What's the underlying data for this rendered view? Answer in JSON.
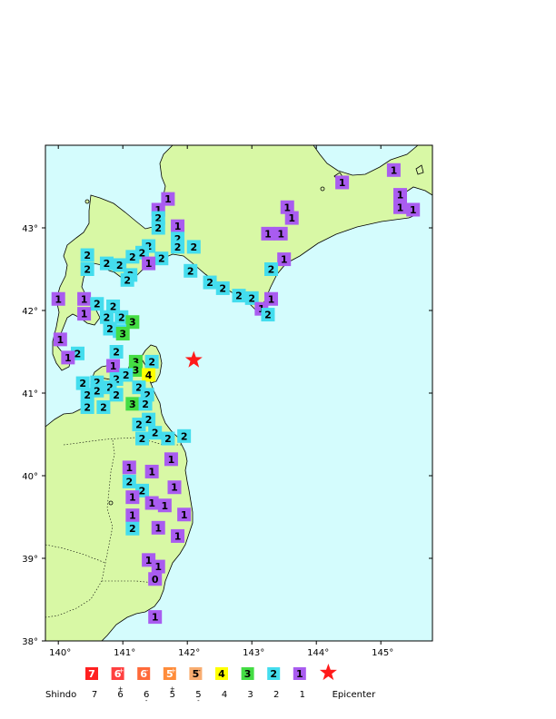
{
  "map": {
    "lon_range": [
      139.8,
      145.8
    ],
    "lat_range": [
      38.0,
      44.0
    ],
    "lon_ticks": [
      "140",
      "141",
      "142",
      "143",
      "144",
      "145"
    ],
    "lat_ticks": [
      "43",
      "42",
      "41",
      "40",
      "39",
      "38"
    ],
    "degree_symbol": "°",
    "sea_color": "#d4fcfd",
    "land_color": "#d8f8a5"
  },
  "epicenter": {
    "lon": 142.1,
    "lat": 41.4,
    "color": "#ff1a1a"
  },
  "stations": [
    {
      "s": "1",
      "lon": 141.7,
      "lat": 43.35
    },
    {
      "s": "1",
      "lon": 141.55,
      "lat": 43.22
    },
    {
      "s": "2",
      "lon": 141.55,
      "lat": 43.12
    },
    {
      "s": "2",
      "lon": 141.55,
      "lat": 43.0
    },
    {
      "s": "1",
      "lon": 141.85,
      "lat": 43.02
    },
    {
      "s": "2",
      "lon": 141.85,
      "lat": 42.87
    },
    {
      "s": "2",
      "lon": 141.85,
      "lat": 42.77
    },
    {
      "s": "2",
      "lon": 142.1,
      "lat": 42.77
    },
    {
      "s": "2",
      "lon": 141.4,
      "lat": 42.78
    },
    {
      "s": "2",
      "lon": 141.3,
      "lat": 42.7
    },
    {
      "s": "2",
      "lon": 141.6,
      "lat": 42.63
    },
    {
      "s": "1",
      "lon": 141.4,
      "lat": 42.57
    },
    {
      "s": "2",
      "lon": 140.45,
      "lat": 42.67
    },
    {
      "s": "2",
      "lon": 140.45,
      "lat": 42.5
    },
    {
      "s": "2",
      "lon": 140.75,
      "lat": 42.57
    },
    {
      "s": "2",
      "lon": 140.95,
      "lat": 42.55
    },
    {
      "s": "2",
      "lon": 141.15,
      "lat": 42.65
    },
    {
      "s": "2",
      "lon": 141.12,
      "lat": 42.43
    },
    {
      "s": "2",
      "lon": 141.07,
      "lat": 42.37
    },
    {
      "s": "2",
      "lon": 142.05,
      "lat": 42.48
    },
    {
      "s": "2",
      "lon": 142.35,
      "lat": 42.34
    },
    {
      "s": "2",
      "lon": 142.55,
      "lat": 42.27
    },
    {
      "s": "2",
      "lon": 142.8,
      "lat": 42.18
    },
    {
      "s": "2",
      "lon": 143.0,
      "lat": 42.15
    },
    {
      "s": "1",
      "lon": 143.3,
      "lat": 42.14
    },
    {
      "s": "1",
      "lon": 143.15,
      "lat": 42.02
    },
    {
      "s": "2",
      "lon": 143.25,
      "lat": 41.95
    },
    {
      "s": "1",
      "lon": 143.55,
      "lat": 43.25
    },
    {
      "s": "1",
      "lon": 143.62,
      "lat": 43.12
    },
    {
      "s": "1",
      "lon": 143.25,
      "lat": 42.93
    },
    {
      "s": "1",
      "lon": 143.45,
      "lat": 42.93
    },
    {
      "s": "1",
      "lon": 143.5,
      "lat": 42.62
    },
    {
      "s": "2",
      "lon": 143.3,
      "lat": 42.5
    },
    {
      "s": "1",
      "lon": 144.4,
      "lat": 43.55
    },
    {
      "s": "1",
      "lon": 145.2,
      "lat": 43.7
    },
    {
      "s": "1",
      "lon": 145.3,
      "lat": 43.4
    },
    {
      "s": "1",
      "lon": 145.3,
      "lat": 43.25
    },
    {
      "s": "1",
      "lon": 145.5,
      "lat": 43.22
    },
    {
      "s": "1",
      "lon": 140.0,
      "lat": 42.14
    },
    {
      "s": "1",
      "lon": 140.4,
      "lat": 42.14
    },
    {
      "s": "2",
      "lon": 140.6,
      "lat": 42.08
    },
    {
      "s": "2",
      "lon": 140.85,
      "lat": 42.05
    },
    {
      "s": "1",
      "lon": 140.4,
      "lat": 41.96
    },
    {
      "s": "2",
      "lon": 140.75,
      "lat": 41.92
    },
    {
      "s": "2",
      "lon": 140.98,
      "lat": 41.92
    },
    {
      "s": "3",
      "lon": 141.15,
      "lat": 41.86
    },
    {
      "s": "2",
      "lon": 140.8,
      "lat": 41.78
    },
    {
      "s": "2",
      "lon": 140.95,
      "lat": 41.75
    },
    {
      "s": "3",
      "lon": 141.0,
      "lat": 41.72
    },
    {
      "s": "1",
      "lon": 140.03,
      "lat": 41.65
    },
    {
      "s": "2",
      "lon": 140.3,
      "lat": 41.48
    },
    {
      "s": "1",
      "lon": 140.15,
      "lat": 41.43
    },
    {
      "s": "2",
      "lon": 140.9,
      "lat": 41.5
    },
    {
      "s": "1",
      "lon": 140.85,
      "lat": 41.33
    },
    {
      "s": "3",
      "lon": 141.2,
      "lat": 41.38
    },
    {
      "s": "2",
      "lon": 141.45,
      "lat": 41.38
    },
    {
      "s": "3",
      "lon": 141.2,
      "lat": 41.28
    },
    {
      "s": "4",
      "lon": 141.4,
      "lat": 41.22
    },
    {
      "s": "2",
      "lon": 141.05,
      "lat": 41.22
    },
    {
      "s": "2",
      "lon": 140.9,
      "lat": 41.17
    },
    {
      "s": "2",
      "lon": 140.6,
      "lat": 41.13
    },
    {
      "s": "2",
      "lon": 140.8,
      "lat": 41.07
    },
    {
      "s": "2",
      "lon": 141.25,
      "lat": 41.07
    },
    {
      "s": "2",
      "lon": 140.38,
      "lat": 41.12
    },
    {
      "s": "2",
      "lon": 140.45,
      "lat": 40.98
    },
    {
      "s": "2",
      "lon": 140.6,
      "lat": 41.03
    },
    {
      "s": "2",
      "lon": 140.9,
      "lat": 40.98
    },
    {
      "s": "2",
      "lon": 141.38,
      "lat": 40.98
    },
    {
      "s": "2",
      "lon": 140.45,
      "lat": 40.83
    },
    {
      "s": "2",
      "lon": 140.7,
      "lat": 40.83
    },
    {
      "s": "3",
      "lon": 141.15,
      "lat": 40.87
    },
    {
      "s": "2",
      "lon": 141.35,
      "lat": 40.87
    },
    {
      "s": "2",
      "lon": 141.25,
      "lat": 40.62
    },
    {
      "s": "2",
      "lon": 141.4,
      "lat": 40.68
    },
    {
      "s": "2",
      "lon": 141.5,
      "lat": 40.52
    },
    {
      "s": "2",
      "lon": 141.3,
      "lat": 40.45
    },
    {
      "s": "2",
      "lon": 141.7,
      "lat": 40.45
    },
    {
      "s": "2",
      "lon": 141.95,
      "lat": 40.48
    },
    {
      "s": "1",
      "lon": 141.75,
      "lat": 40.2
    },
    {
      "s": "1",
      "lon": 141.1,
      "lat": 40.1
    },
    {
      "s": "1",
      "lon": 141.45,
      "lat": 40.05
    },
    {
      "s": "2",
      "lon": 141.1,
      "lat": 39.93
    },
    {
      "s": "2",
      "lon": 141.3,
      "lat": 39.82
    },
    {
      "s": "1",
      "lon": 141.8,
      "lat": 39.86
    },
    {
      "s": "1",
      "lon": 141.15,
      "lat": 39.74
    },
    {
      "s": "1",
      "lon": 141.45,
      "lat": 39.67
    },
    {
      "s": "1",
      "lon": 141.65,
      "lat": 39.64
    },
    {
      "s": "1",
      "lon": 141.15,
      "lat": 39.52
    },
    {
      "s": "1",
      "lon": 141.95,
      "lat": 39.53
    },
    {
      "s": "2",
      "lon": 141.15,
      "lat": 39.36
    },
    {
      "s": "1",
      "lon": 141.55,
      "lat": 39.37
    },
    {
      "s": "1",
      "lon": 141.85,
      "lat": 39.27
    },
    {
      "s": "1",
      "lon": 141.4,
      "lat": 38.98
    },
    {
      "s": "1",
      "lon": 141.55,
      "lat": 38.9
    },
    {
      "s": "0",
      "lon": 141.5,
      "lat": 38.75
    },
    {
      "s": "1",
      "lon": 141.5,
      "lat": 38.29
    }
  ],
  "legend": {
    "title": "Shindo",
    "items": [
      {
        "box": "7",
        "label": "7",
        "bg": "#ff2020",
        "fg": "#ffffff"
      },
      {
        "box": "6",
        "mark": "+",
        "label": "6",
        "bg": "#ff4040",
        "fg": "#ffffff"
      },
      {
        "box": "6",
        "mark": "-",
        "label": "6",
        "bg": "#ff6a3a",
        "fg": "#ffffff"
      },
      {
        "box": "5",
        "mark": "+",
        "label": "5",
        "bg": "#ff8c3a",
        "fg": "#ffffff"
      },
      {
        "box": "5",
        "mark": "-",
        "label": "5",
        "bg": "#f9ad70",
        "fg": "#000000"
      },
      {
        "box": "4",
        "label": "4",
        "bg": "#ffff00",
        "fg": "#000000"
      },
      {
        "box": "3",
        "label": "3",
        "bg": "#44dd44",
        "fg": "#000000"
      },
      {
        "box": "2",
        "label": "2",
        "bg": "#44ddee",
        "fg": "#000000"
      },
      {
        "box": "1",
        "label": "1",
        "bg": "#a95cf0",
        "fg": "#000000"
      }
    ],
    "epicenter_label": "Epicenter"
  },
  "shindo_colors": {
    "0": "#a95cf0",
    "1": "#a95cf0",
    "2": "#44ddee",
    "3": "#44dd44",
    "4": "#ffff00"
  }
}
